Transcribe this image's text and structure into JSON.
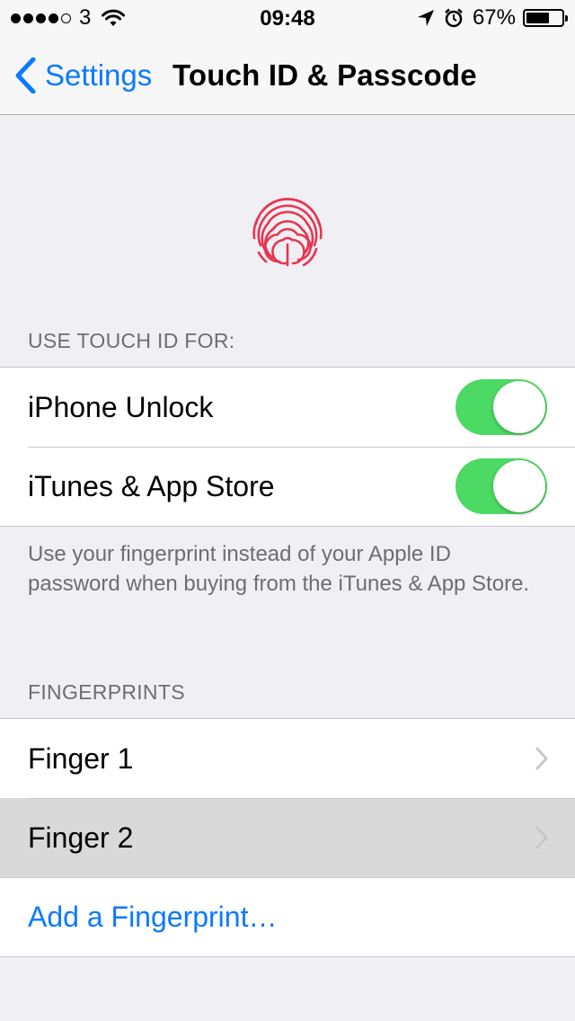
{
  "status_bar": {
    "carrier": "3",
    "time": "09:48",
    "battery_percent": "67%",
    "battery_level": 0.67,
    "signal_bars": 4,
    "signal_total": 5,
    "icons": [
      "wifi-icon",
      "location-arrow-icon",
      "alarm-clock-icon",
      "battery-icon"
    ]
  },
  "nav": {
    "back_label": "Settings",
    "title": "Touch ID & Passcode"
  },
  "colors": {
    "accent": "#0a7aff",
    "toggle_on": "#4cd964",
    "fingerprint": "#e8354e",
    "background": "#efeff4"
  },
  "touch_id": {
    "header": "USE TOUCH ID FOR:",
    "items": [
      {
        "label": "iPhone Unlock",
        "enabled": true
      },
      {
        "label": "iTunes & App Store",
        "enabled": true
      }
    ],
    "footer": "Use your fingerprint instead of your Apple ID password when buying from the iTunes & App Store."
  },
  "fingerprints": {
    "header": "FINGERPRINTS",
    "items": [
      {
        "label": "Finger 1"
      },
      {
        "label": "Finger 2"
      }
    ],
    "add_label": "Add a Fingerprint…"
  }
}
